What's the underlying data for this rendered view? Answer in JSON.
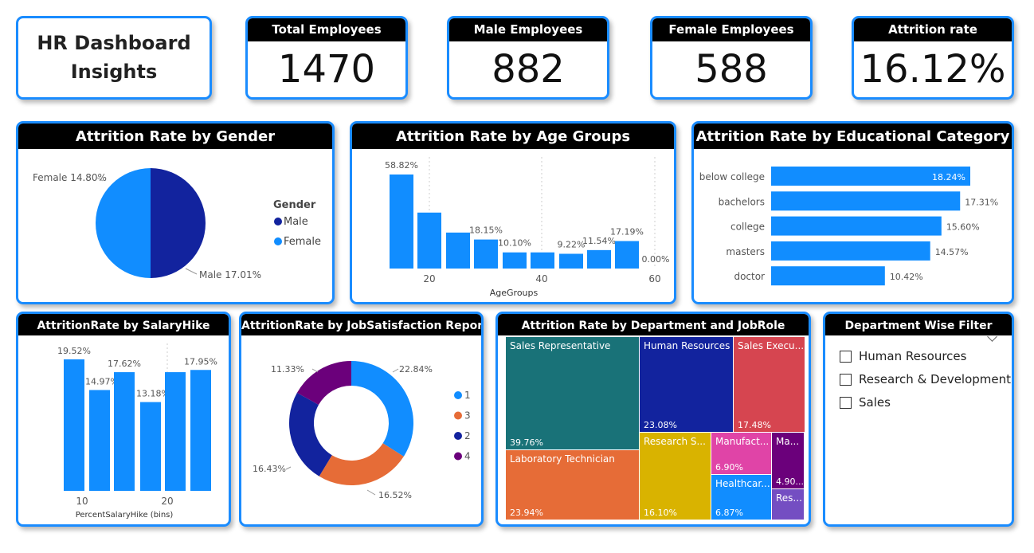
{
  "title": {
    "line1": "HR Dashboard",
    "line2": "Insights"
  },
  "kpis": [
    {
      "label": "Total Employees",
      "value": "1470"
    },
    {
      "label": "Male Employees",
      "value": "882"
    },
    {
      "label": "Female Employees",
      "value": "588"
    },
    {
      "label": "Attrition rate",
      "value": "16.12%"
    }
  ],
  "gender_chart": {
    "title": "Attrition Rate by Gender",
    "legend_title": "Gender",
    "colors": {
      "Male": "#12239e",
      "Female": "#118dff"
    },
    "chart_data": {
      "type": "pie",
      "labels": [
        "Male",
        "Female"
      ],
      "values": [
        17.01,
        14.8
      ],
      "data_labels": [
        "Male 17.01%",
        "Female 14.80%"
      ],
      "legend_position": "right"
    }
  },
  "age_chart": {
    "title": "Attrition Rate by Age Groups",
    "color": "#118dff",
    "chart_data": {
      "type": "bar",
      "xlabel": "AgeGroups",
      "x_ticks": [
        "20",
        "40",
        "60"
      ],
      "x_tick_values": [
        20,
        40,
        60
      ],
      "values": [
        58.82,
        35.0,
        22.5,
        18.15,
        10.1,
        10.1,
        9.22,
        11.54,
        17.19,
        0.0
      ],
      "data_labels": [
        "58.82%",
        "",
        "",
        "18.15%",
        "10.10%",
        "",
        "9.22%",
        "11.54%",
        "17.19%",
        "0.00%"
      ]
    }
  },
  "edu_chart": {
    "title": "Attrition Rate by Educational Category",
    "color": "#118dff",
    "chart_data": {
      "type": "bar",
      "orientation": "horizontal",
      "categories": [
        "below college",
        "bachelors",
        "college",
        "masters",
        "doctor"
      ],
      "values": [
        18.24,
        17.31,
        15.6,
        14.57,
        10.42
      ],
      "data_labels": [
        "18.24%",
        "17.31%",
        "15.60%",
        "14.57%",
        "10.42%"
      ]
    }
  },
  "salary_chart": {
    "title": "AttritionRate by SalaryHike",
    "color": "#118dff",
    "chart_data": {
      "type": "bar",
      "xlabel": "PercentSalaryHike (bins)",
      "x_ticks": [
        "10",
        "20"
      ],
      "values": [
        19.52,
        14.97,
        17.62,
        13.18,
        17.62,
        17.95
      ],
      "data_labels": [
        "19.52%",
        "14.97%",
        "17.62%",
        "13.18%",
        "",
        "17.95%"
      ]
    }
  },
  "jobsat_chart": {
    "title": "AttritionRate by JobSatisfaction Report",
    "chart_data": {
      "type": "pie",
      "variant": "donut",
      "labels": [
        "1",
        "3",
        "2",
        "4"
      ],
      "values": [
        22.84,
        16.52,
        16.43,
        11.33
      ],
      "data_labels": [
        "22.84%",
        "16.52%",
        "16.43%",
        "11.33%"
      ],
      "colors": [
        "#118dff",
        "#e66c37",
        "#12239e",
        "#6b007b"
      ],
      "legend_position": "right"
    }
  },
  "dept_chart": {
    "title": "Attrition Rate by Department and JobRole",
    "chart_data": {
      "type": "treemap",
      "items": [
        {
          "name": "Sales Representative",
          "value": "39.76%",
          "color": "#197278"
        },
        {
          "name": "Laboratory Technician",
          "value": "23.94%",
          "color": "#e66c37"
        },
        {
          "name": "Human Resources",
          "value": "23.08%",
          "color": "#12239e"
        },
        {
          "name": "Sales Execu...",
          "value": "17.48%",
          "color": "#d64550"
        },
        {
          "name": "Research S...",
          "value": "16.10%",
          "color": "#d9b300"
        },
        {
          "name": "Manufact...",
          "value": "6.90%",
          "color": "#e044a7"
        },
        {
          "name": "Healthcar...",
          "value": "6.87%",
          "color": "#118dff"
        },
        {
          "name": "Ma...",
          "value": "4.90...",
          "color": "#6b007b"
        },
        {
          "name": "Res...",
          "value": "",
          "color": "#744ec2"
        }
      ]
    }
  },
  "filter": {
    "title": "Department Wise Filter",
    "options": [
      "Human Resources",
      "Research & Development",
      "Sales"
    ]
  }
}
